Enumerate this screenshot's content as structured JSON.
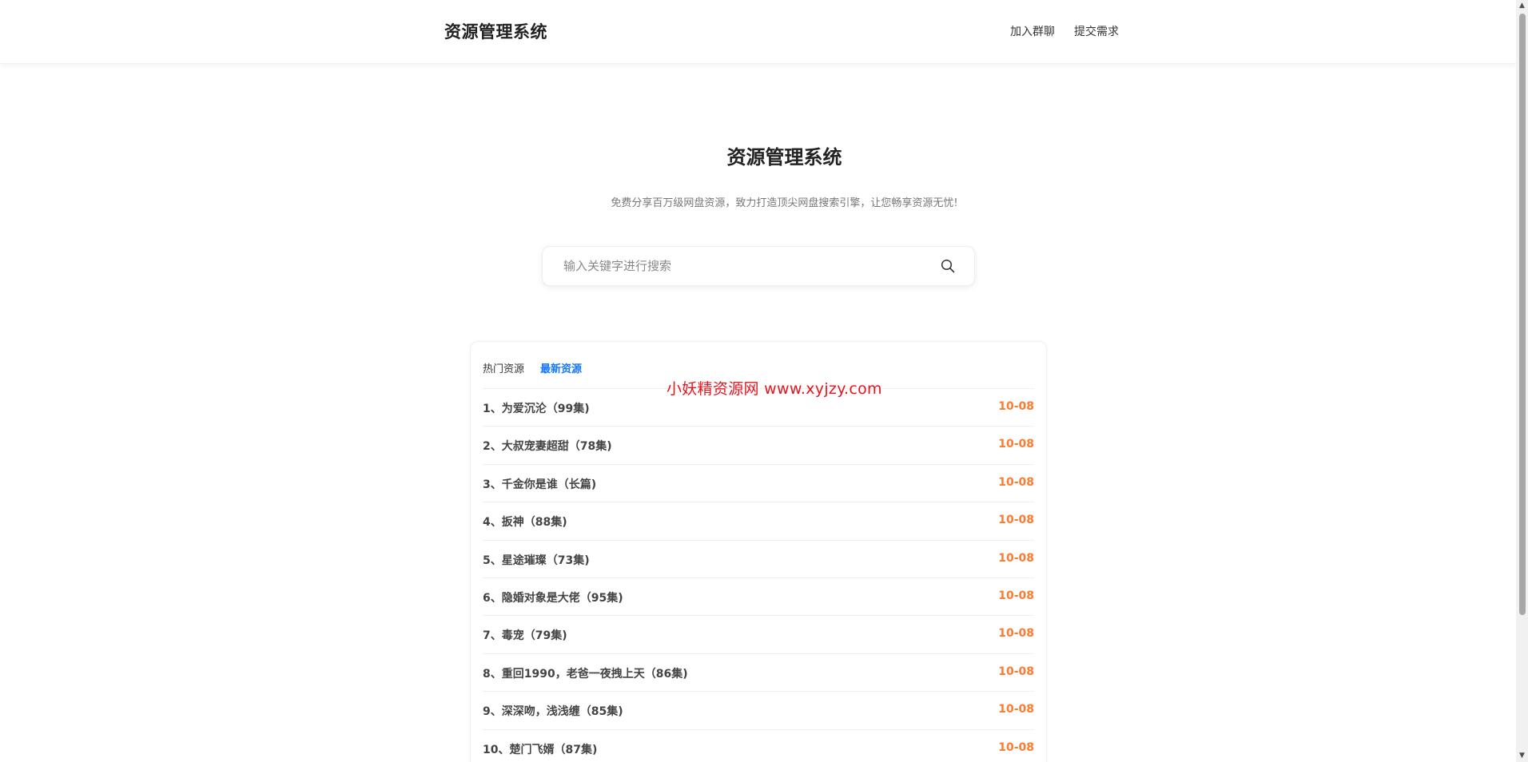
{
  "header": {
    "brand": "资源管理系统",
    "nav": [
      "加入群聊",
      "提交需求"
    ]
  },
  "hero": {
    "title": "资源管理系统",
    "subtitle": "免费分享百万级网盘资源，致力打造顶尖网盘搜索引擎，让您畅享资源无忧!"
  },
  "search": {
    "placeholder": "输入关键字进行搜索",
    "value": "",
    "icon": "search-icon"
  },
  "tabs": [
    {
      "label": "热门资源",
      "active": false
    },
    {
      "label": "最新资源",
      "active": true
    }
  ],
  "watermark": "小妖精资源网 www.xyjzy.com",
  "items": [
    {
      "title": "1、为爱沉沦（99集)",
      "date": "10-08"
    },
    {
      "title": "2、大叔宠妻超甜（78集)",
      "date": "10-08"
    },
    {
      "title": "3、千金你是谁（长篇)",
      "date": "10-08"
    },
    {
      "title": "4、扳神（88集)",
      "date": "10-08"
    },
    {
      "title": "5、星途璀璨（73集)",
      "date": "10-08"
    },
    {
      "title": "6、隐婚对象是大佬（95集)",
      "date": "10-08"
    },
    {
      "title": "7、毒宠（79集)",
      "date": "10-08"
    },
    {
      "title": "8、重回1990，老爸一夜拽上天（86集)",
      "date": "10-08"
    },
    {
      "title": "9、深深吻，浅浅缠（85集)",
      "date": "10-08"
    },
    {
      "title": "10、楚门飞婿（87集)",
      "date": "10-08"
    }
  ],
  "colors": {
    "accent": "#1677ff",
    "date": "#ff7a2e",
    "watermark": "#e8141c"
  }
}
